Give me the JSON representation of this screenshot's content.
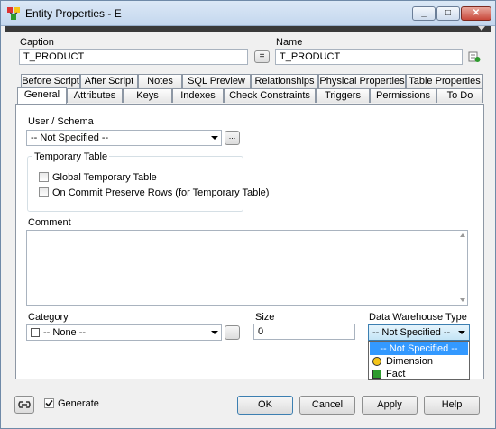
{
  "window": {
    "title": "Entity Properties - E"
  },
  "caption": {
    "label": "Caption",
    "value": "T_PRODUCT"
  },
  "equals_button": "=",
  "name": {
    "label": "Name",
    "value": "T_PRODUCT"
  },
  "tabs_row1": [
    "Before Script",
    "After Script",
    "Notes",
    "SQL Preview",
    "Relationships",
    "Physical Properties",
    "Table Properties"
  ],
  "tabs_row2": [
    "General",
    "Attributes",
    "Keys",
    "Indexes",
    "Check Constraints",
    "Triggers",
    "Permissions",
    "To Do"
  ],
  "general": {
    "user_schema": {
      "label": "User / Schema",
      "value": "-- Not Specified --"
    },
    "ellipsis": "...",
    "temporary_table": {
      "label": "Temporary Table",
      "global": "Global Temporary Table",
      "on_commit": "On Commit Preserve Rows (for Temporary Table)"
    },
    "comment": {
      "label": "Comment",
      "value": ""
    },
    "category": {
      "label": "Category",
      "value": "-- None --"
    },
    "size": {
      "label": "Size",
      "value": "0"
    },
    "data_warehouse": {
      "label": "Data Warehouse Type",
      "value": "-- Not Specified --",
      "options": [
        "-- Not Specified --",
        "Dimension",
        "Fact"
      ]
    }
  },
  "footer": {
    "generate_label": "Generate",
    "generate_checked": true,
    "ok": "OK",
    "cancel": "Cancel",
    "apply": "Apply",
    "help": "Help"
  },
  "colors": {
    "dimension": "#f5c518",
    "fact": "#2e9b2e",
    "selection": "#3399ff"
  }
}
